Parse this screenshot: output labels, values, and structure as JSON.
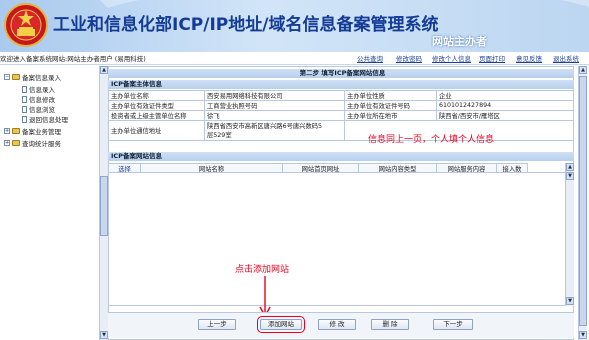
{
  "banner": {
    "title": "工业和信息化部ICP/IP地址/域名信息备案管理系统",
    "subtitle": "网站主办者"
  },
  "topbar": {
    "welcome": "欢迎进入备案系统网站:网站主办者用户 (易用科技)",
    "links": [
      "公共查询",
      "修改密码",
      "修改个人信息",
      "页面打印",
      "意见反馈",
      "退出系统"
    ]
  },
  "tree": {
    "root1": "备案信息录入",
    "children": [
      "信息录入",
      "信息修改",
      "信息浏览",
      "退回信息处理"
    ],
    "root2": "备案业务管理",
    "root3": "查询统计服务"
  },
  "main": {
    "step_title": "第二步  填写ICP备案网站信息",
    "section1": "ICP备案主体信息",
    "rows": [
      {
        "l1": "主办单位名称",
        "v1": "西安易用网络科技有限公司",
        "l2": "主办单位性质",
        "v2": "企业"
      },
      {
        "l1": "主办单位有效证件类型",
        "v1": "工商营业执照号码",
        "l2": "主办单位有效证件号码",
        "v2": "6101012427894"
      },
      {
        "l1": "投资者或上级主管单位名称",
        "v1": "徐飞",
        "l2": "主办单位所在地市",
        "v2": "陕西省/西安市/雁塔区"
      },
      {
        "l1": "主办单位通信地址",
        "v1a": "陕西省西安市高新区唐兴路6号唐兴数码5",
        "v1b": "层529室",
        "annotation": "信息同上一页，个人填个人信息"
      }
    ],
    "section2": "ICP备案网站信息",
    "grid_cols": [
      "选择",
      "网站名称",
      "网站首页网址",
      "网站内容类型",
      "网站服务内容",
      "接入数"
    ],
    "click_hint": "点击添加网站",
    "buttons": {
      "prev": "上一步",
      "add": "添加网站",
      "edit": "修 改",
      "delete": "删 除",
      "next": "下一步"
    }
  },
  "colors": {
    "annotation": "#e8001c",
    "header_bg": "#c3d7f0",
    "banner_title": "#143c96"
  }
}
